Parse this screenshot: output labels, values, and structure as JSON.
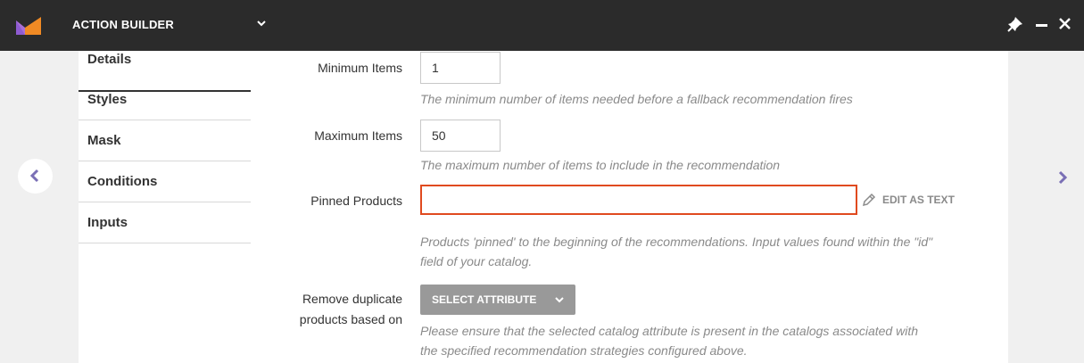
{
  "app": {
    "title": "ACTION BUILDER"
  },
  "sidebar": {
    "items": [
      {
        "label": "Details"
      },
      {
        "label": "Styles"
      },
      {
        "label": "Mask"
      },
      {
        "label": "Conditions"
      },
      {
        "label": "Inputs"
      }
    ]
  },
  "form": {
    "min_items": {
      "label": "Minimum Items",
      "value": "1",
      "help": "The minimum number of items needed before a fallback recommendation fires"
    },
    "max_items": {
      "label": "Maximum Items",
      "value": "50",
      "help": "The maximum number of items to include in the recommendation"
    },
    "pinned_products": {
      "label": "Pinned Products",
      "value": "",
      "edit_label": "EDIT AS TEXT",
      "help_line1": "Products 'pinned' to the beginning of the recommendations. Input values found within the \"id\"",
      "help_line2": "field of your catalog."
    },
    "remove_duplicates": {
      "label_line1": "Remove duplicate",
      "label_line2": "products based on",
      "button_label": "SELECT ATTRIBUTE",
      "help_line1": "Please ensure that the selected catalog attribute is present in the catalogs associated with",
      "help_line2": "the specified recommendation strategies configured above."
    }
  },
  "colors": {
    "topbar": "#2b2b2b",
    "accent_error": "#e04a1f",
    "nav_arrow": "#7a6fb5",
    "logo_orange": "#f08a24",
    "logo_purple": "#8e5bd1"
  },
  "icons": {
    "logo": "brand-logo-icon",
    "dropdown": "chevron-down-icon",
    "pin": "pin-icon",
    "minimize": "minimize-icon",
    "close": "close-icon",
    "prev": "chevron-left-icon",
    "next": "chevron-right-icon",
    "edit": "pencil-icon"
  }
}
